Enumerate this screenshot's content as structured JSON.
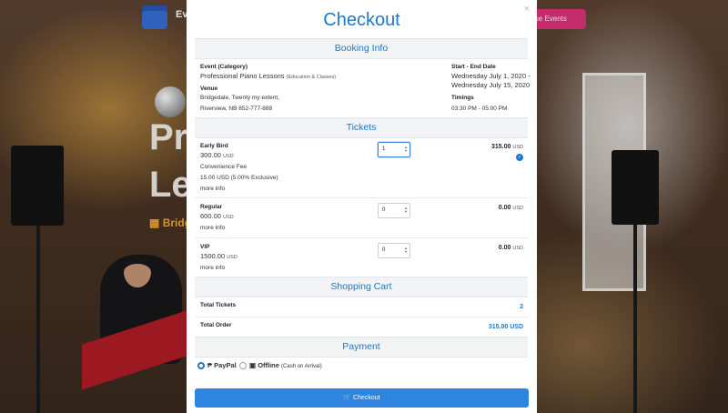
{
  "background": {
    "brand": "Ev",
    "browse_button": "wse Events",
    "hero_line1": "Pr",
    "hero_line2": "Le",
    "venue_snippet": "Bridg"
  },
  "modal": {
    "title": "Checkout",
    "close_icon": "×",
    "booking": {
      "section_title": "Booking Info",
      "event_label": "Event (Category)",
      "event_name": "Professional Piano Lessons",
      "event_category": "(Education & Classes)",
      "venue_label": "Venue",
      "venue_line1": "Bridgedale, Twenty my extent,",
      "venue_line2": "Riverview, NB 852-777-888",
      "dates_label": "Start - End Date",
      "start_date": "Wednesday July 1, 2020 -",
      "end_date": "Wednesday July 15, 2020",
      "timings_label": "Timings",
      "timings": "03:30 PM - 05:00 PM"
    },
    "tickets": {
      "section_title": "Tickets",
      "items": [
        {
          "name": "Early Bird",
          "price": "300.00",
          "currency": "USD",
          "fee_label": "Convenience Fee",
          "fee_value": "15.00 USD (5.00% Exclusive)",
          "more_info": "more info",
          "qty": "1",
          "total": "315.00",
          "total_currency": "USD"
        },
        {
          "name": "Regular",
          "price": "600.00",
          "currency": "USD",
          "more_info": "more info",
          "qty": "0",
          "total": "0.00",
          "total_currency": "USD"
        },
        {
          "name": "VIP",
          "price": "1500.00",
          "currency": "USD",
          "more_info": "more info",
          "qty": "0",
          "total": "0.00",
          "total_currency": "USD"
        }
      ]
    },
    "cart": {
      "section_title": "Shopping Cart",
      "total_tickets_label": "Total Tickets",
      "total_tickets": "2",
      "total_order_label": "Total Order",
      "total_order": "315.00 USD"
    },
    "payment": {
      "section_title": "Payment",
      "paypal_label": "PayPal",
      "offline_label": "Offline",
      "offline_note": "(Cash on Arrival)",
      "selected": "paypal"
    },
    "checkout_button": "Checkout"
  },
  "colors": {
    "accent": "#1f77c9",
    "button": "#2f84df",
    "browse": "#e0317a"
  }
}
